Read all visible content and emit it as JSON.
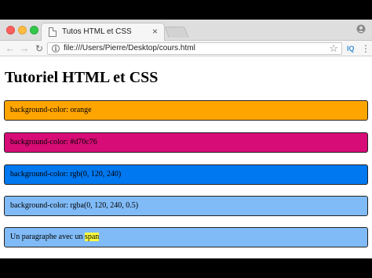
{
  "browser": {
    "tab": {
      "title": "Tutos HTML et CSS",
      "close_glyph": "×"
    },
    "toolbar": {
      "back_glyph": "←",
      "forward_glyph": "→",
      "reload_glyph": "↻",
      "info_glyph": "i",
      "url": "file:///Users/Pierre/Desktop/cours.html",
      "star_glyph": "☆",
      "extension_label": "IQ",
      "menu_glyph": "⋮"
    },
    "traffic_colors": {
      "close": "#fc605c",
      "minimize": "#fdbc40",
      "maximize": "#34c84a"
    }
  },
  "page": {
    "title": "Tutoriel HTML et CSS",
    "boxes": [
      {
        "text": "background-color: orange",
        "color": "#ffa500"
      },
      {
        "text": "background-color: #d70c76",
        "color": "#d70c76"
      },
      {
        "text": "background-color: rgb(0, 120, 240)",
        "color": "#0078f0"
      },
      {
        "text": "background-color: rgba(0, 120, 240, 0.5)",
        "color": "#80bbf7"
      }
    ],
    "paragraph": {
      "text_before": "Un paragraphe avec un ",
      "span_text": "span",
      "span_color": "#ffff40",
      "background": "#80bbf7"
    }
  }
}
